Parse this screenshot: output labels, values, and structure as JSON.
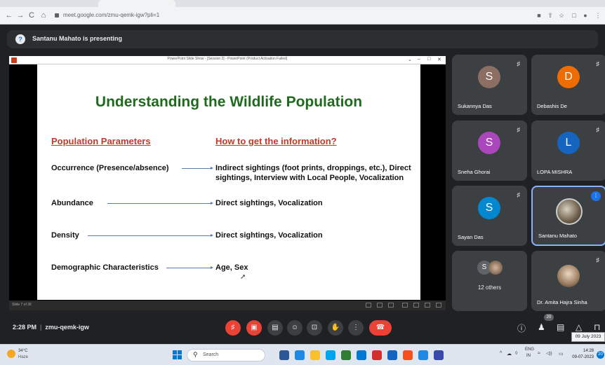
{
  "browser": {
    "url": "meet.google.com/zmu-qemk-igw?pli=1",
    "back_icon": "←",
    "forward_icon": "→",
    "reload_icon": "C",
    "home_icon": "⌂",
    "ext_icons": [
      "■",
      "⇧",
      "☆",
      "□",
      "●",
      "⋮"
    ]
  },
  "meet": {
    "presenting_text": "Santanu Mahato is presenting",
    "presenting_icon": "?"
  },
  "ppt": {
    "window_title": "PowerPoint Slide Show - [Session 2] - PowerPoint (Product Activation Failed)",
    "controls": [
      "⌄",
      "–",
      "□",
      "✕"
    ],
    "slide_number": "Slide 7 of 36"
  },
  "slide": {
    "title": "Understanding the Wildlife Population",
    "col_left_header": "Population Parameters",
    "col_right_header": "How to get the information",
    "col_right_q": "?",
    "rows": [
      {
        "label": "Occurrence (Presence/absence)",
        "info": "Indirect sightings (foot prints, droppings, etc.), Direct sightings, Interview with Local People, Vocalization"
      },
      {
        "label": "Abundance",
        "info": "Direct sightings, Vocalization"
      },
      {
        "label": "Density",
        "info": "Direct sightings, Vocalization"
      },
      {
        "label": "Demographic Characteristics",
        "info": "Age, Sex"
      }
    ]
  },
  "participants": [
    {
      "name": "Sukannya Das",
      "initial": "S",
      "color": "#8d6e63"
    },
    {
      "name": "Debashis De",
      "initial": "D",
      "color": "#ef6c00"
    },
    {
      "name": "Sneha Ghorai",
      "initial": "S",
      "color": "#ab47bc"
    },
    {
      "name": "LOPA MISHRA",
      "initial": "L",
      "color": "#1565c0"
    },
    {
      "name": "Sayan Das",
      "initial": "S",
      "color": "#0288d1"
    },
    {
      "name": "Santanu Mahato",
      "initial": ""
    },
    {
      "name": "Dr. Amita Hajra Sinha",
      "initial": ""
    }
  ],
  "others": {
    "label": "12 others",
    "initial": "S"
  },
  "mute_icon": "♯",
  "controls": {
    "time": "2:28 PM",
    "meeting_code": "zmu-qemk-igw",
    "separator": "|",
    "mic_icon": "♯",
    "cam_icon": "▣",
    "cc_icon": "▤",
    "emoji_icon": "☺",
    "present_icon": "⊡",
    "hand_icon": "✋",
    "more_icon": "⋮",
    "end_icon": "☎",
    "info_icon": "ⓘ",
    "people_icon": "♟",
    "chat_icon": "▤",
    "activities_icon": "△",
    "lock_icon": "⊓",
    "participant_count": "20",
    "date_tooltip": "09 July 2023"
  },
  "taskbar": {
    "temp": "34°C",
    "condition": "Haze",
    "search_placeholder": "Search",
    "search_icon": "⚲",
    "apps": [
      "#2b5797",
      "#1e88e5",
      "#fbc02d",
      "#00a4ef",
      "#2e7d32",
      "#0078d4",
      "#d32f2f",
      "#1565c0",
      "#f4511e",
      "#1e88e5",
      "#3949ab"
    ],
    "tray_up": "^",
    "tray_cloud": "☁",
    "tray_speaker": "◊",
    "lang": "ENG",
    "lang_sub": "IN",
    "wifi": "≈",
    "vol": "◁))",
    "battery": "▭",
    "time": "14:28",
    "date": "09-07-2023",
    "notif_count": "20"
  }
}
